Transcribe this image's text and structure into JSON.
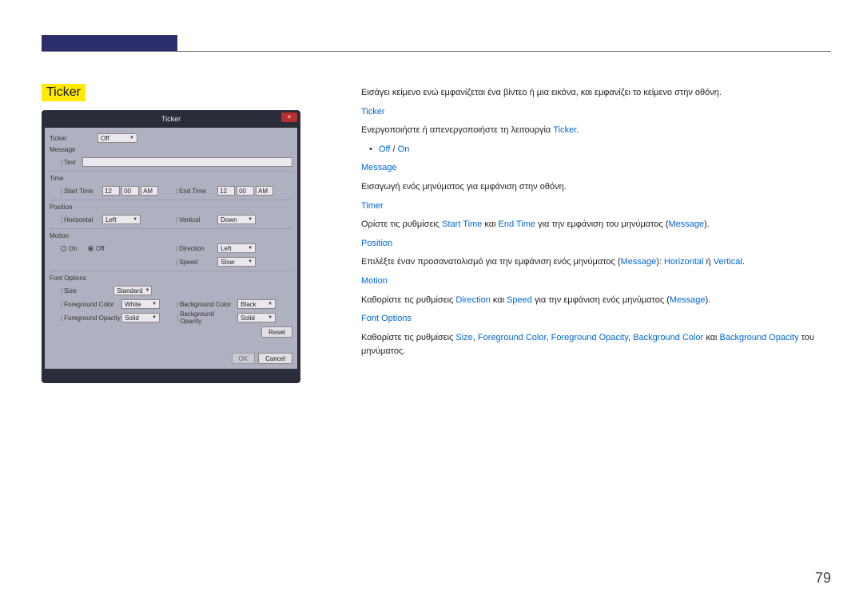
{
  "pageTitle": "Ticker",
  "pageNumber": "79",
  "dialog": {
    "title": "Ticker",
    "close": "×",
    "tickerLabel": "Ticker",
    "tickerValue": "Off",
    "messageLabel": "Message",
    "messageFieldLabel": "Text",
    "timeLabel": "Time",
    "startTimeLabel": "Start Time",
    "startH": "12",
    "startM": "00",
    "startAMPM": "AM",
    "endTimeLabel": "End Time",
    "endH": "12",
    "endM": "00",
    "endAMPM": "AM",
    "positionLabel": "Position",
    "horizontalLabel": "Horizontal",
    "horizontalValue": "Left",
    "verticalLabel": "Vertical",
    "verticalValue": "Down",
    "motionLabel": "Motion",
    "motionOn": "On",
    "motionOff": "Off",
    "directionLabel": "Direction",
    "directionValue": "Left",
    "speedLabel": "Speed",
    "speedValue": "Slow",
    "fontOptionsLabel": "Font Options",
    "sizeLabel": "Size",
    "sizeValue": "Standard",
    "fgColorLabel": "Foreground Color",
    "fgColorValue": "White",
    "fgOpacityLabel": "Foreground Opacity",
    "fgOpacityValue": "Solid",
    "bgColorLabel": "Background Color",
    "bgColorValue": "Black",
    "bgOpacityLabel": "Background Opacity",
    "bgOpacityValue": "Solid",
    "resetBtn": "Reset",
    "okBtn": "OK",
    "cancelBtn": "Cancel"
  },
  "body": {
    "intro": "Εισάγει κείμενο ενώ εμφανίζεται ένα βίντεο ή μια εικόνα, και εμφανίζει το κείμενο στην οθόνη.",
    "ticker": "Ticker",
    "t_enable_pre": "Ενεργοποιήστε ή απενεργοποιήστε τη λειτουργία ",
    "t_enable_ticker": "Ticker",
    "t_enable_post": ".",
    "off": "Off",
    "sep": " / ",
    "on": "On",
    "message": "Message",
    "msgText": "Εισαγωγή ενός μηνύματος για εμφάνιση στην οθόνη.",
    "timer": "Timer",
    "timer_pre": "Ορίστε τις ρυθμίσεις ",
    "startTime": "Start Time",
    "timer_and": " και ",
    "endTime": "End Time",
    "timer_post1": " για την εμφάνιση του μηνύματος (",
    "msgWord": "Message",
    "timer_post2": ").",
    "position": "Position",
    "pos_pre": "Επιλέξτε έναν προσανατολισμό για την εμφάνιση ενός μηνύματος (",
    "pos_mid": "): ",
    "horizontal": "Horizontal",
    "pos_or": " ή ",
    "vertical": "Vertical",
    "pos_end": ".",
    "motion": "Motion",
    "motion_pre": "Καθορίστε τις ρυθμίσεις ",
    "direction": "Direction",
    "motion_and": " και ",
    "speed": "Speed",
    "motion_post1": " για την εμφάνιση ενός μηνύματος (",
    "motion_post2": ").",
    "fontOptions": "Font Options",
    "fo_pre": "Καθορίστε τις ρυθμίσεις ",
    "size": "Size",
    "fo_c1": ", ",
    "fgColor": "Foreground Color",
    "fo_c2": ", ",
    "fgOpacity": "Foreground Opacity",
    "fo_c3": ", ",
    "bgColor": "Background Color",
    "fo_and": " και ",
    "bgOpacity": "Background Opacity",
    "fo_post": " του μηνύματος."
  }
}
